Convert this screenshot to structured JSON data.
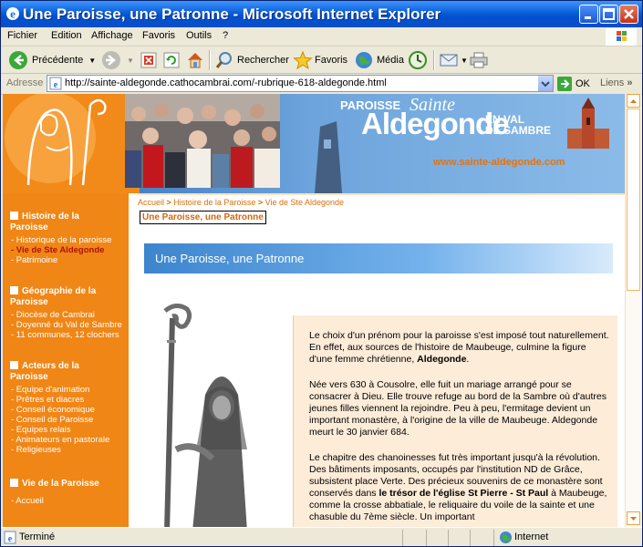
{
  "window": {
    "title": "Une Paroisse, une Patronne - Microsoft Internet Explorer"
  },
  "menubar": {
    "items": [
      "Fichier",
      "Edition",
      "Affichage",
      "Favoris",
      "Outils",
      "?"
    ]
  },
  "toolbar": {
    "back_label": "Précédente",
    "search_label": "Rechercher",
    "favorites_label": "Favoris",
    "media_label": "Média"
  },
  "address": {
    "label": "Adresse",
    "url": "http://sainte-aldegonde.cathocambrai.com/-rubrique-618-aldegonde.html",
    "go_label": "OK",
    "links_label": "Liens"
  },
  "banner": {
    "line1": "PAROISSE",
    "line2_script": "Sainte",
    "line2": "Aldegonde",
    "line3a": "EN VAL",
    "line3b": "DE SAMBRE",
    "site": "www.sainte-aldegonde.com"
  },
  "sidebar": {
    "sections": [
      {
        "heading": "Histoire de la Paroisse",
        "items": [
          "- Historique de la paroisse",
          "- Vie de Ste Aldegonde",
          "- Patrimoine"
        ],
        "current": 1
      },
      {
        "heading": "Géographie de la Paroisse",
        "items": [
          "- Diocèse de Cambrai",
          "- Doyenné du Val de Sambre",
          "- 11 communes, 12 clochers"
        ],
        "current": -1
      },
      {
        "heading": "Acteurs de la Paroisse",
        "items": [
          "- Equipe d'animation",
          "- Prêtres et diacres",
          "- Conseil économique",
          "- Conseil de Paroisse",
          "- Equipes relais",
          "- Animateurs en pastorale",
          "- Religieuses"
        ],
        "current": -1
      },
      {
        "heading": "Vie de la Paroisse",
        "items": [
          "- Accueil"
        ],
        "current": -1
      }
    ]
  },
  "breadcrumb": {
    "items": [
      "Accueil",
      "Histoire de la Paroisse",
      "Vie de Ste Aldegonde"
    ],
    "separator": ">"
  },
  "page": {
    "title_box": "Une Paroisse, une Patronne",
    "heading": "Une Paroisse, une Patronne",
    "para1_a": "Le choix d'un prénom pour la paroisse s'est imposé tout naturellement. En effet, aux sources de l'histoire de Maubeuge, culmine la figure d'une femme chrétienne, ",
    "para1_b": "Aldegonde",
    "para1_c": ".",
    "para2": "Née vers 630 à Cousolre, elle fuit un mariage arrangé pour se consacrer à Dieu. Elle trouve refuge au bord de la Sambre où d'autres jeunes filles viennent la rejoindre. Peu à peu, l'ermitage devient un important monastère, à l'origine de la ville de Maubeuge. Aldegonde meurt le 30 janvier 684.",
    "para3_a": "Le chapitre des chanoinesses fut très important jusqu'à la révolution. Des bâtiments imposants, occupés par l'institution ND de Grâce, subsistent place Verte. Des précieux souvenirs de ce monastère sont conservés dans ",
    "para3_b": "le trésor de l'église St Pierre - St Paul",
    "para3_c": " à Maubeuge, comme la crosse abbatiale, le reliquaire du voile de la sainte et une chasuble du 7ème siècle. Un important"
  },
  "status": {
    "text": "Terminé",
    "zone": "Internet"
  },
  "colors": {
    "orange": "#f08616",
    "blue": "#3c85cd"
  }
}
